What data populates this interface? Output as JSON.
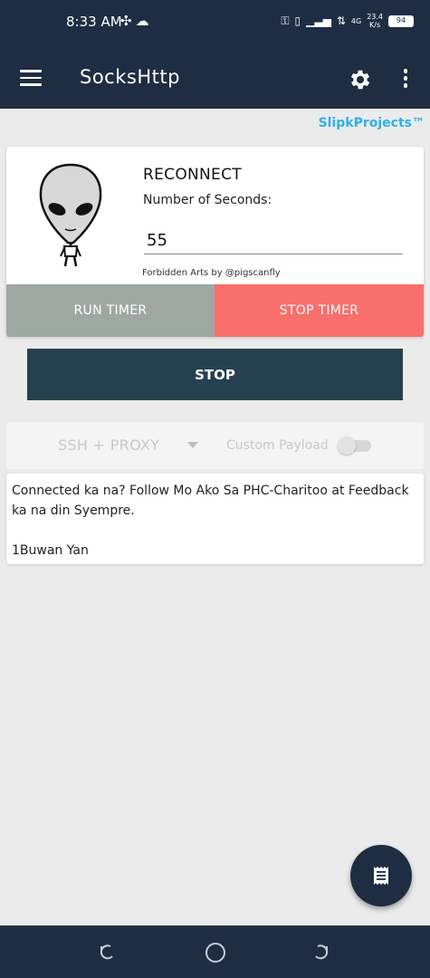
{
  "status_bar": {
    "time": "8:33 AM",
    "left_icons": [
      "fan-icon",
      "cloud-icon"
    ],
    "right_icons": [
      "key-icon",
      "vibrate-icon",
      "signal-icon",
      "data-icon",
      "signal-4g-icon"
    ],
    "net_speed": "23.4",
    "net_unit": "K/s",
    "net_type": "4G",
    "battery": "94"
  },
  "app_bar": {
    "title": "SocksHttp",
    "icons": [
      "menu-icon",
      "gear-icon",
      "more-vert-icon"
    ]
  },
  "brand": "SlipkProjects™",
  "reconnect": {
    "title": "RECONNECT",
    "label": "Number of Seconds:",
    "value": "55",
    "credit": "Forbidden Arts by @pigscanfly",
    "run_label": "RUN TIMER",
    "stop_label": "STOP TIMER"
  },
  "main_button": "STOP",
  "options": {
    "mode": "SSH + PROXY",
    "payload_label": "Custom Payload",
    "payload_enabled": false
  },
  "message": {
    "line1": "Connected ka na? Follow Mo Ako Sa PHC-Charitoo at Feedback",
    "line2": "ka na din Syempre.",
    "line3": "1Buwan Yan"
  },
  "fab_icon": "receipt-icon",
  "nav_icons": [
    "back-icon",
    "home-icon",
    "recent-icon"
  ],
  "colors": {
    "primary": "#1f2d43",
    "brand": "#2fb0e8",
    "run_timer": "#9fa8a3",
    "stop_timer": "#f86f6c",
    "stop_button": "#27404f"
  }
}
